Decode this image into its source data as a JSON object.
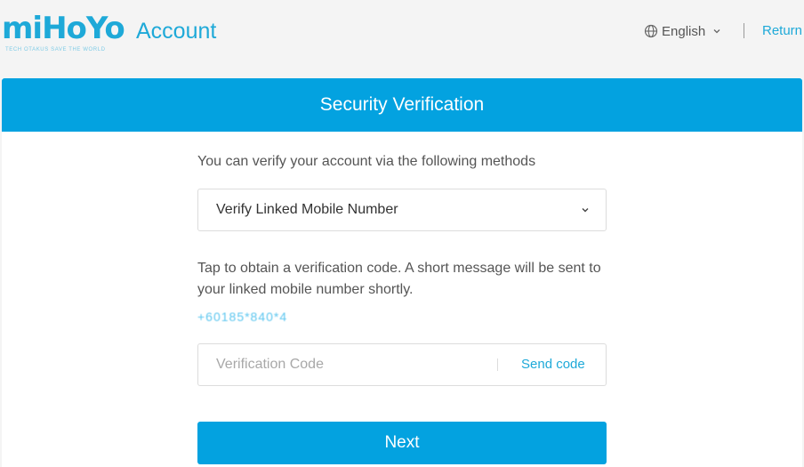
{
  "header": {
    "logo_text": "miHoYo",
    "logo_tagline": "TECH OTAKUS SAVE THE WORLD",
    "title": "Account",
    "language": "English",
    "return_label": "Return"
  },
  "panel": {
    "title": "Security Verification",
    "intro": "You can verify your account via the following methods",
    "method_selected": "Verify Linked Mobile Number",
    "description": "Tap to obtain a verification code. A short message will be sent to your linked mobile number shortly.",
    "phone_masked": "+60185*840*4",
    "code_placeholder": "Verification Code",
    "send_code_label": "Send code",
    "next_label": "Next"
  },
  "colors": {
    "accent": "#03a2e0",
    "link": "#1ea9d8",
    "background": "#f4f4f4"
  },
  "icons": {
    "language": "globe-icon",
    "dropdown": "chevron-down-icon"
  }
}
